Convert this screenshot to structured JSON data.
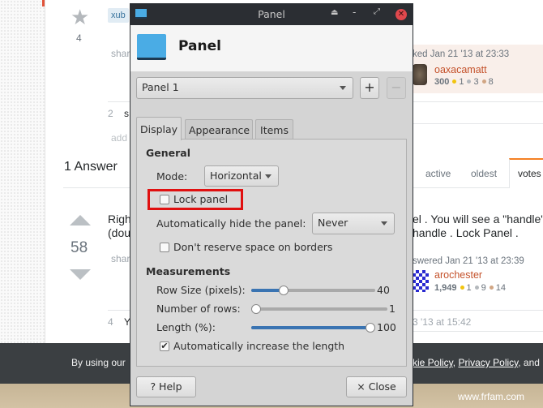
{
  "page": {
    "star_count": "4",
    "tag": "xub",
    "share1": "shar",
    "comment1_votes": "2",
    "comment1_text": "s",
    "add_comment": "add",
    "answers_heading": "1 Answer",
    "asked": "ked Jan 21 '13 at 23:33",
    "asker": {
      "name": "oaxacamatt",
      "rep": "300",
      "gold": "1",
      "silver": "3",
      "bronze": "8"
    },
    "sort_tabs": [
      "active",
      "oldest",
      "votes"
    ],
    "selected_sort": "votes",
    "answer_votes": "58",
    "answer_line1_left": "Righ",
    "answer_line2_left": "(dou",
    "answer_line1_right": "el . You will see a \"handle\"",
    "answer_line2_right": "handle . Lock Panel .",
    "share2": "shar",
    "answered": "swered Jan 21 '13 at 23:39",
    "answerer": {
      "name": "arochester",
      "rep": "1,949",
      "gold": "1",
      "silver": "9",
      "bronze": "14"
    },
    "comment2_votes": "4",
    "comment2_text": "Y",
    "comment2_time": "3 '13 at 15:42",
    "cookie_left": "By using our",
    "cookie_links": [
      "kie Policy",
      "Privacy Policy"
    ],
    "cookie_right_tail": ", and",
    "watermark": "www.frfam.com",
    "accent": "#c4512a"
  },
  "dialog": {
    "window_title": "Panel",
    "header_title": "Panel",
    "panel_select": "Panel 1",
    "add_label": "+",
    "remove_label": "−",
    "tabs": [
      "Display",
      "Appearance",
      "Items"
    ],
    "active_tab": "Display",
    "general_heading": "General",
    "mode_label": "Mode:",
    "mode_value": "Horizontal",
    "lock_panel_label": "Lock panel",
    "lock_panel_checked": false,
    "autohide_label": "Automatically hide the panel:",
    "autohide_value": "Never",
    "reserve_label": "Don't reserve space on borders",
    "reserve_checked": false,
    "measurements_heading": "Measurements",
    "row_size_label": "Row Size (pixels):",
    "row_size_value": "40",
    "row_size_fraction": 0.24,
    "rows_label": "Number of rows:",
    "rows_value": "1",
    "rows_fraction": 0,
    "length_label": "Length (%):",
    "length_value": "100",
    "length_fraction": 1,
    "auto_length_label": "Automatically increase the length",
    "auto_length_checked": true,
    "check_mark": "✔",
    "help_label": "? Help",
    "close_label": "× Close",
    "highlight_color": "#e01010"
  }
}
